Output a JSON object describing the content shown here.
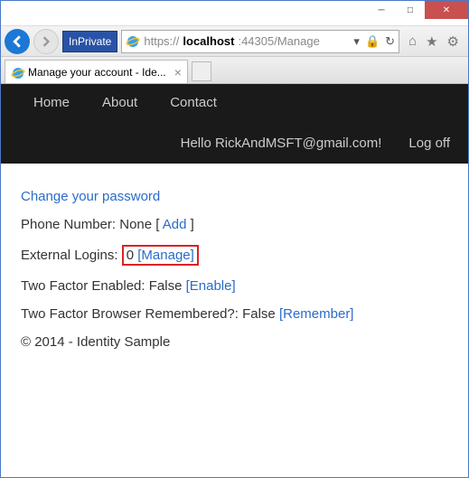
{
  "window": {
    "minimize": "─",
    "maximize": "□",
    "close": "✕"
  },
  "browser": {
    "inprivate": "InPrivate",
    "url_scheme": "https://",
    "url_host": "localhost",
    "url_rest": ":44305/Manage",
    "tab_title": "Manage your account - Ide..."
  },
  "nav": {
    "home": "Home",
    "about": "About",
    "contact": "Contact",
    "hello": "Hello RickAndMSFT@gmail.com!",
    "logoff": "Log off"
  },
  "account": {
    "change_password": "Change your password",
    "phone_label": "Phone Number: ",
    "phone_value": "None",
    "add_link": "Add",
    "ext_logins_label": "External Logins: ",
    "ext_logins_count": "0",
    "manage_link": "[Manage]",
    "tfe_label": "Two Factor Enabled: ",
    "tfe_value": "False",
    "enable_link": "[Enable]",
    "tfb_label": "Two Factor Browser Remembered?: ",
    "tfb_value": "False",
    "remember_link": "[Remember]"
  },
  "footer": {
    "text": "© 2014 - Identity Sample"
  }
}
